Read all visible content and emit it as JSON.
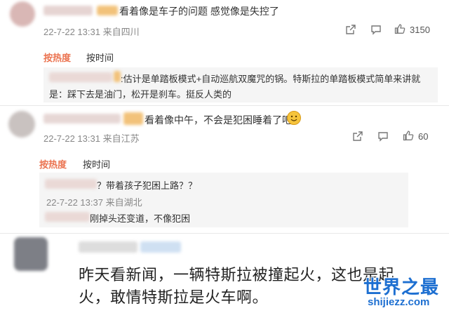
{
  "comment1": {
    "text": "看着像是车子的问题 感觉像是失控了",
    "meta": "22-7-22 13:31 来自四川",
    "likes": "3150"
  },
  "sort1": {
    "hot": "按热度",
    "time": "按时间"
  },
  "reply1": {
    "line1": ":估计是单踏板模式+自动巡航双魔咒的锅。特斯拉的单踏板模式简单来讲就",
    "line2": "是：踩下去是油门，松开是刹车。挺反人类的"
  },
  "comment2": {
    "text": "看着像中午，不会是犯困睡着了吧",
    "meta": "22-7-22 13:31 来自江苏",
    "likes": "60"
  },
  "sort2": {
    "hot": "按热度",
    "time": "按时间"
  },
  "reply2": {
    "text": "？带着孩子犯困上路？？",
    "meta": "22-7-22 13:37 来自湖北"
  },
  "reply3": {
    "text": "刚掉头还变道，不像犯困"
  },
  "comment3": {
    "line1": "昨天看新闻，一辆特斯拉被撞起火，这也是起",
    "line2": "火，敢情特斯拉是火车啊。"
  },
  "watermark": {
    "cn": "世界之最",
    "en": "shijiezz.com"
  },
  "colors": {
    "hot_sort": "#eb7350",
    "watermark": "#1d6fd1"
  }
}
